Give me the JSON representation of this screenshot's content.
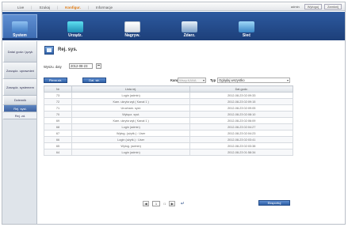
{
  "topnav": {
    "items": [
      {
        "label": "Live"
      },
      {
        "label": "Szukaj"
      },
      {
        "label": "Konfigur.",
        "active": true
      },
      {
        "label": "Informacje"
      }
    ],
    "user": "admin",
    "buttons": [
      "Wyloguj",
      "Zamknij"
    ]
  },
  "tabs": [
    {
      "label": "System",
      "icon": "system-icon",
      "active": true
    },
    {
      "label": "Urządz.",
      "icon": "device-icon"
    },
    {
      "label": "Nagryw.",
      "icon": "record-icon"
    },
    {
      "label": "Zdarz.",
      "icon": "event-icon"
    },
    {
      "label": "Sieć",
      "icon": "network-icon"
    }
  ],
  "sidebar": [
    {
      "label": "Data/ godz./ język"
    },
    {
      "label": "Zarządz. uprawnień"
    },
    {
      "label": "Zarządz. systemem"
    },
    {
      "label": "Dziennik"
    },
    {
      "label": "Rej. syst.",
      "active": true
    },
    {
      "label": "Rej. zd.",
      "sub": true
    }
  ],
  "page": {
    "title": "Rej. sys.",
    "date_label": "Wyszu. daty",
    "date_value": "2012-08-23",
    "first_button": "Pierw.str.",
    "prev_button": "Dal. str.",
    "channel_label": "Kanał",
    "channel_placeholder": "Wszy.KANA",
    "type_label": "Typ",
    "type_value": "Oglądaj wszystko",
    "export_button": "Eksportuj"
  },
  "table": {
    "headers": {
      "no": "Nr",
      "desc": "Lista rej.",
      "time": "Dat.godz."
    },
    "rows": [
      {
        "no": "73",
        "desc": "Login (admin)",
        "time": "2012-08-23 02:09:33"
      },
      {
        "no": "72",
        "desc": "Kam. ukryta wył.( Kanał 1 )",
        "time": "2012-08-23 02:09:15"
      },
      {
        "no": "71",
        "desc": "Urucham. syst.",
        "time": "2012-08-23 02:09:05"
      },
      {
        "no": "70",
        "desc": "Wyłącz. syst.",
        "time": "2012-08-23 02:08:10"
      },
      {
        "no": "69",
        "desc": "Kam. ukryta wył.( Kanał 1 )",
        "time": "2012-08-23 02:06:09"
      },
      {
        "no": "68",
        "desc": "Login (admin)",
        "time": "2012-08-23 02:04:27"
      },
      {
        "no": "67",
        "desc": "Wyłog. (użytk.) : User",
        "time": "2012-08-23 02:04:23"
      },
      {
        "no": "66",
        "desc": "Login (użytk.) : User",
        "time": "2012-08-23 02:03:41"
      },
      {
        "no": "65",
        "desc": "Wylog. (admin)",
        "time": "2012-08-23 02:03:38"
      },
      {
        "no": "64",
        "desc": "Login (admin)",
        "time": "2012-08-23 01:58:34"
      }
    ]
  },
  "pager": {
    "current": "1",
    "total": "/1"
  }
}
